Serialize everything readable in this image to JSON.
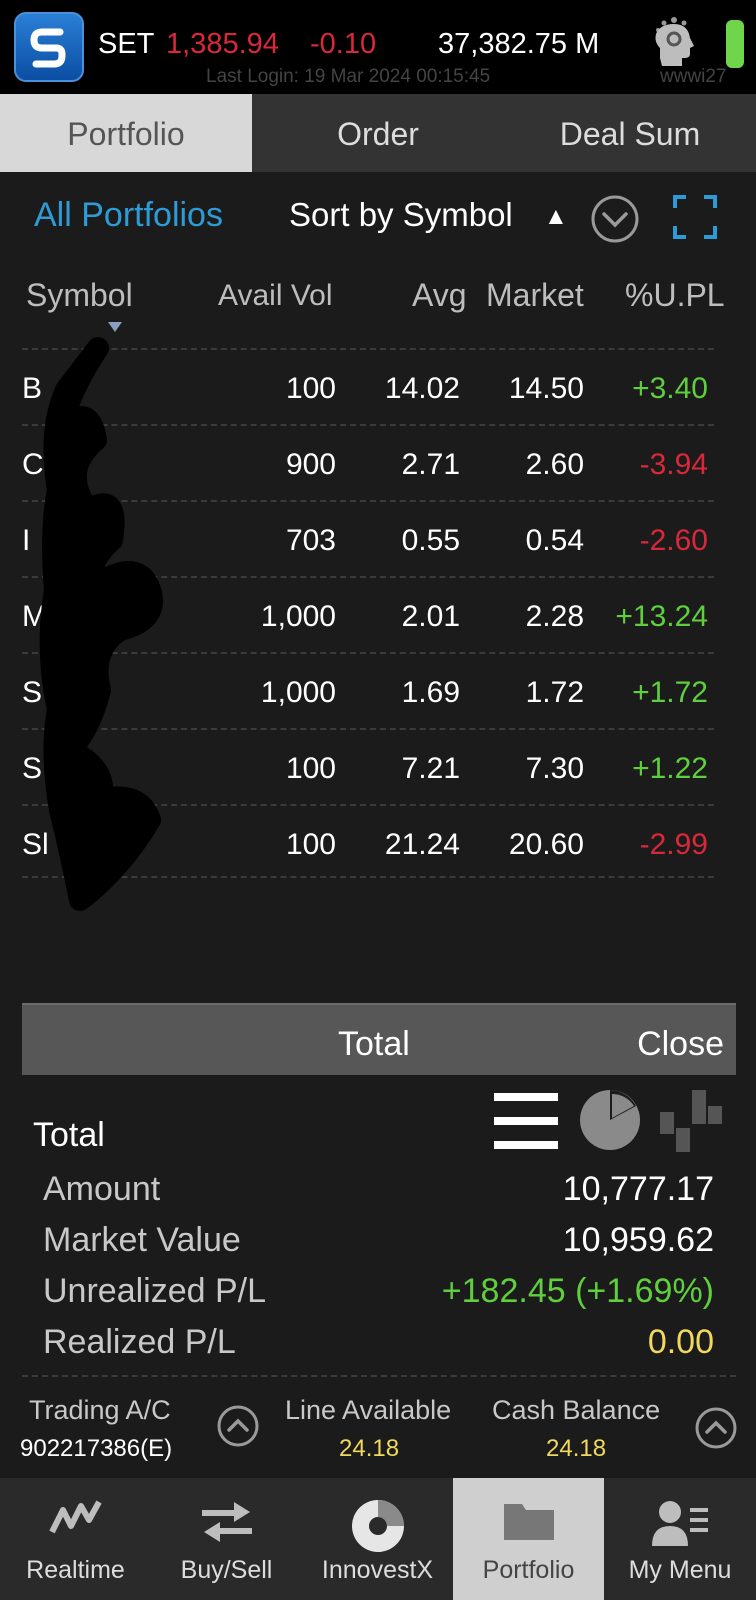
{
  "header": {
    "index_name": "SET",
    "index_value": "1,385.94",
    "index_change": "-0.10",
    "volume": "37,382.75 M",
    "last_login": "Last Login: 19 Mar 2024 00:15:45",
    "user_code": "wwwi27",
    "icons": [
      "app-logo-icon",
      "profile-head-icon",
      "battery-icon"
    ]
  },
  "tabs": [
    {
      "label": "Portfolio",
      "active": true
    },
    {
      "label": "Order",
      "active": false
    },
    {
      "label": "Deal Sum",
      "active": false
    }
  ],
  "filter": {
    "portfolio": "All Portfolios",
    "sort": "Sort by Symbol",
    "sort_direction": "▲"
  },
  "table": {
    "columns": [
      "Symbol",
      "Avail Vol",
      "Avg",
      "Market",
      "%U.PL"
    ],
    "rows": [
      {
        "symbol": "B",
        "avail_vol": "100",
        "avg": "14.02",
        "market": "14.50",
        "upl": "+3.40",
        "status": "pos"
      },
      {
        "symbol": "Cl",
        "avail_vol": "900",
        "avg": "2.71",
        "market": "2.60",
        "upl": "-3.94",
        "status": "neg"
      },
      {
        "symbol": "I",
        "avail_vol": "703",
        "avg": "0.55",
        "market": "0.54",
        "upl": "-2.60",
        "status": "neg"
      },
      {
        "symbol": "M",
        "avail_vol": "1,000",
        "avg": "2.01",
        "market": "2.28",
        "upl": "+13.24",
        "status": "pos"
      },
      {
        "symbol": "S'",
        "avail_vol": "1,000",
        "avg": "1.69",
        "market": "1.72",
        "upl": "+1.72",
        "status": "pos"
      },
      {
        "symbol": "S",
        "avail_vol": "100",
        "avg": "7.21",
        "market": "7.30",
        "upl": "+1.22",
        "status": "pos"
      },
      {
        "symbol": "Sl",
        "avail_vol": "100",
        "avg": "21.24",
        "market": "20.60",
        "upl": "-2.99",
        "status": "neg"
      }
    ]
  },
  "total_panel": {
    "bar_title": "Total",
    "close_label": "Close",
    "title": "Total",
    "amount_label": "Amount",
    "amount_value": "10,777.17",
    "market_value_label": "Market Value",
    "market_value_value": "10,959.62",
    "unrealized_label": "Unrealized P/L",
    "unrealized_value": "+182.45 (+1.69%)",
    "realized_label": "Realized P/L",
    "realized_value": "0.00"
  },
  "account": {
    "trading_label": "Trading A/C",
    "trading_value": "902217386(E)",
    "line_label": "Line Available",
    "line_value": "24.18",
    "cash_label": "Cash Balance",
    "cash_value": "24.18"
  },
  "nav": [
    {
      "label": "Realtime",
      "icon": "chart-line-icon"
    },
    {
      "label": "Buy/Sell",
      "icon": "buy-sell-icon"
    },
    {
      "label": "InnovestX",
      "icon": "innovestx-icon"
    },
    {
      "label": "Portfolio",
      "icon": "folder-icon",
      "active": true
    },
    {
      "label": "My Menu",
      "icon": "user-menu-icon"
    }
  ],
  "colors": {
    "positive": "#5fcf3d",
    "negative": "#d8283a",
    "accent": "#2e9bd6",
    "realized": "#f0d95c"
  }
}
